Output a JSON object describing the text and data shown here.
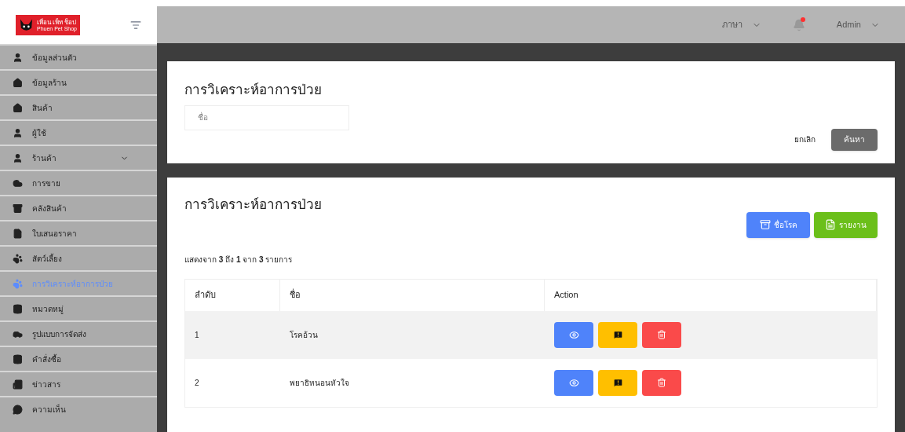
{
  "logo": {
    "title": "เพื่อน เพ็ท ช็อป",
    "subtitle": "Phuen Pet Shop"
  },
  "sidebar": {
    "items": [
      {
        "label": "ข้อมูลส่วนตัว",
        "selected": false
      },
      {
        "label": "ข้อมูลร้าน",
        "selected": false
      },
      {
        "label": "สินค้า",
        "selected": false
      },
      {
        "label": "ผู้ใช้",
        "selected": false
      },
      {
        "label": "ร้านค้า",
        "selected": false,
        "expandable": true
      },
      {
        "label": "การขาย",
        "selected": false
      },
      {
        "label": "คลังสินค้า",
        "selected": false
      },
      {
        "label": "ใบเสนอราคา",
        "selected": false
      },
      {
        "label": "สัตว์เลี้ยง",
        "selected": false
      },
      {
        "label": "การวิเคราะห์อาการป่วย",
        "selected": true
      },
      {
        "label": "หมวดหมู่",
        "selected": false
      },
      {
        "label": "รูปแบบการจัดส่ง",
        "selected": false
      },
      {
        "label": "คำสั่งซื้อ",
        "selected": false
      },
      {
        "label": "ข่าวสาร",
        "selected": false
      },
      {
        "label": "ความเห็น",
        "selected": false
      }
    ]
  },
  "header": {
    "language": "ภาษา",
    "notification": true,
    "user": "Admin"
  },
  "search_card": {
    "title": "การวิเคราะห์อาการป่วย",
    "name_field": {
      "placeholder": "ชื่อ"
    },
    "cancel": "ยกเลิก",
    "search": "ค้นหา"
  },
  "list_card": {
    "title": "การวิเคราะห์อาการป่วย",
    "buttons": [
      "ชื่อโรค",
      "รายงาน"
    ],
    "summary": "แสดงจาก **3** ถึง **1** จาก **3** รายการ",
    "table": {
      "columns": [
        "ลำดับ",
        "ชื่อ",
        "Action"
      ],
      "rows": [
        {
          "index": "1",
          "name": "โรคอ้วน"
        },
        {
          "index": "2",
          "name": "พยาธิหนอนหัวใจ"
        }
      ]
    }
  }
}
